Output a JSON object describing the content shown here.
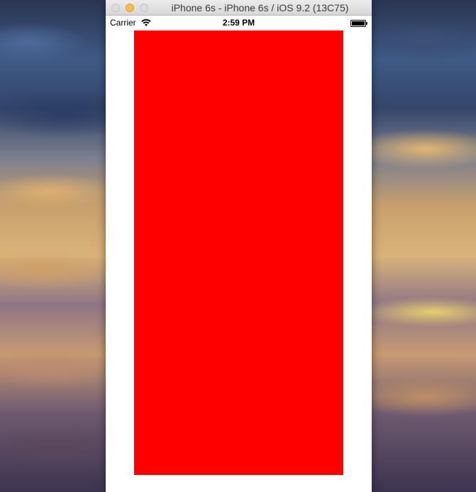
{
  "window": {
    "title": "iPhone 6s - iPhone 6s / iOS 9.2 (13C75)"
  },
  "status_bar": {
    "carrier": "Carrier",
    "time": "2:59 PM",
    "wifi_icon": "wifi-icon",
    "battery_icon": "battery-icon"
  },
  "screen": {
    "view_color": "#ff0000",
    "background_color": "#ffffff"
  }
}
